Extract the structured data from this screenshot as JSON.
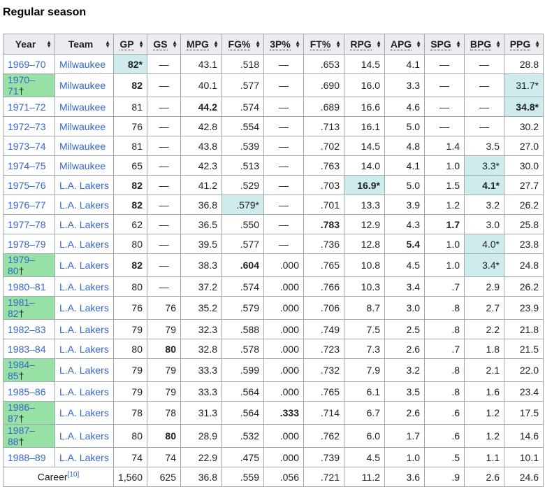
{
  "heading": "Regular season",
  "columns": [
    {
      "key": "year",
      "label": "Year",
      "abbr": false
    },
    {
      "key": "team",
      "label": "Team",
      "abbr": false
    },
    {
      "key": "gp",
      "label": "GP",
      "abbr": true
    },
    {
      "key": "gs",
      "label": "GS",
      "abbr": true
    },
    {
      "key": "mpg",
      "label": "MPG",
      "abbr": true
    },
    {
      "key": "fg",
      "label": "FG%",
      "abbr": true
    },
    {
      "key": "three",
      "label": "3P%",
      "abbr": true
    },
    {
      "key": "ft",
      "label": "FT%",
      "abbr": true
    },
    {
      "key": "rpg",
      "label": "RPG",
      "abbr": true
    },
    {
      "key": "apg",
      "label": "APG",
      "abbr": true
    },
    {
      "key": "spg",
      "label": "SPG",
      "abbr": true
    },
    {
      "key": "bpg",
      "label": "BPG",
      "abbr": true
    },
    {
      "key": "ppg",
      "label": "PPG",
      "abbr": true
    }
  ],
  "rows": [
    {
      "year": "1969–70",
      "team": "Milwaukee",
      "gp": "82*",
      "gs": "—",
      "mpg": "43.1",
      "fg": ".518",
      "three": "—",
      "ft": ".653",
      "rpg": "14.5",
      "apg": "4.1",
      "spg": "—",
      "bpg": "—",
      "ppg": "28.8",
      "lead": [
        "gp"
      ],
      "bold": [
        "gp"
      ]
    },
    {
      "year": "1970–71†",
      "team": "Milwaukee",
      "gp": "82",
      "gs": "—",
      "mpg": "40.1",
      "fg": ".577",
      "three": "—",
      "ft": ".690",
      "rpg": "16.0",
      "apg": "3.3",
      "spg": "—",
      "bpg": "—",
      "ppg": "31.7*",
      "champ": true,
      "lead": [
        "ppg"
      ],
      "bold": [
        "gp"
      ]
    },
    {
      "year": "1971–72",
      "team": "Milwaukee",
      "gp": "81",
      "gs": "—",
      "mpg": "44.2",
      "fg": ".574",
      "three": "—",
      "ft": ".689",
      "rpg": "16.6",
      "apg": "4.6",
      "spg": "—",
      "bpg": "—",
      "ppg": "34.8*",
      "lead": [
        "ppg"
      ],
      "bold": [
        "mpg",
        "ppg"
      ]
    },
    {
      "year": "1972–73",
      "team": "Milwaukee",
      "gp": "76",
      "gs": "—",
      "mpg": "42.8",
      "fg": ".554",
      "three": "—",
      "ft": ".713",
      "rpg": "16.1",
      "apg": "5.0",
      "spg": "—",
      "bpg": "—",
      "ppg": "30.2"
    },
    {
      "year": "1973–74",
      "team": "Milwaukee",
      "gp": "81",
      "gs": "—",
      "mpg": "43.8",
      "fg": ".539",
      "three": "—",
      "ft": ".702",
      "rpg": "14.5",
      "apg": "4.8",
      "spg": "1.4",
      "bpg": "3.5",
      "ppg": "27.0"
    },
    {
      "year": "1974–75",
      "team": "Milwaukee",
      "gp": "65",
      "gs": "—",
      "mpg": "42.3",
      "fg": ".513",
      "three": "—",
      "ft": ".763",
      "rpg": "14.0",
      "apg": "4.1",
      "spg": "1.0",
      "bpg": "3.3*",
      "ppg": "30.0",
      "lead": [
        "bpg"
      ]
    },
    {
      "year": "1975–76",
      "team": "L.A. Lakers",
      "gp": "82",
      "gs": "—",
      "mpg": "41.2",
      "fg": ".529",
      "three": "—",
      "ft": ".703",
      "rpg": "16.9*",
      "apg": "5.0",
      "spg": "1.5",
      "bpg": "4.1*",
      "ppg": "27.7",
      "lead": [
        "rpg",
        "bpg"
      ],
      "bold": [
        "gp",
        "rpg",
        "bpg"
      ]
    },
    {
      "year": "1976–77",
      "team": "L.A. Lakers",
      "gp": "82",
      "gs": "—",
      "mpg": "36.8",
      "fg": ".579*",
      "three": "—",
      "ft": ".701",
      "rpg": "13.3",
      "apg": "3.9",
      "spg": "1.2",
      "bpg": "3.2",
      "ppg": "26.2",
      "lead": [
        "fg"
      ],
      "bold": [
        "gp"
      ]
    },
    {
      "year": "1977–78",
      "team": "L.A. Lakers",
      "gp": "62",
      "gs": "—",
      "mpg": "36.5",
      "fg": ".550",
      "three": "—",
      "ft": ".783",
      "rpg": "12.9",
      "apg": "4.3",
      "spg": "1.7",
      "bpg": "3.0",
      "ppg": "25.8",
      "bold": [
        "ft",
        "spg"
      ]
    },
    {
      "year": "1978–79",
      "team": "L.A. Lakers",
      "gp": "80",
      "gs": "—",
      "mpg": "39.5",
      "fg": ".577",
      "three": "—",
      "ft": ".736",
      "rpg": "12.8",
      "apg": "5.4",
      "spg": "1.0",
      "bpg": "4.0*",
      "ppg": "23.8",
      "lead": [
        "bpg"
      ],
      "bold": [
        "apg"
      ]
    },
    {
      "year": "1979–80†",
      "team": "L.A. Lakers",
      "gp": "82",
      "gs": "—",
      "mpg": "38.3",
      "fg": ".604",
      "three": ".000",
      "ft": ".765",
      "rpg": "10.8",
      "apg": "4.5",
      "spg": "1.0",
      "bpg": "3.4*",
      "ppg": "24.8",
      "champ": true,
      "lead": [
        "bpg"
      ],
      "bold": [
        "gp",
        "fg"
      ]
    },
    {
      "year": "1980–81",
      "team": "L.A. Lakers",
      "gp": "80",
      "gs": "—",
      "mpg": "37.2",
      "fg": ".574",
      "three": ".000",
      "ft": ".766",
      "rpg": "10.3",
      "apg": "3.4",
      "spg": ".7",
      "bpg": "2.9",
      "ppg": "26.2"
    },
    {
      "year": "1981–82†",
      "team": "L.A. Lakers",
      "gp": "76",
      "gs": "76",
      "mpg": "35.2",
      "fg": ".579",
      "three": ".000",
      "ft": ".706",
      "rpg": "8.7",
      "apg": "3.0",
      "spg": ".8",
      "bpg": "2.7",
      "ppg": "23.9",
      "champ": true
    },
    {
      "year": "1982–83",
      "team": "L.A. Lakers",
      "gp": "79",
      "gs": "79",
      "mpg": "32.3",
      "fg": ".588",
      "three": ".000",
      "ft": ".749",
      "rpg": "7.5",
      "apg": "2.5",
      "spg": ".8",
      "bpg": "2.2",
      "ppg": "21.8"
    },
    {
      "year": "1983–84",
      "team": "L.A. Lakers",
      "gp": "80",
      "gs": "80",
      "mpg": "32.8",
      "fg": ".578",
      "three": ".000",
      "ft": ".723",
      "rpg": "7.3",
      "apg": "2.6",
      "spg": ".7",
      "bpg": "1.8",
      "ppg": "21.5",
      "bold": [
        "gs"
      ]
    },
    {
      "year": "1984–85†",
      "team": "L.A. Lakers",
      "gp": "79",
      "gs": "79",
      "mpg": "33.3",
      "fg": ".599",
      "three": ".000",
      "ft": ".732",
      "rpg": "7.9",
      "apg": "3.2",
      "spg": ".8",
      "bpg": "2.1",
      "ppg": "22.0",
      "champ": true
    },
    {
      "year": "1985–86",
      "team": "L.A. Lakers",
      "gp": "79",
      "gs": "79",
      "mpg": "33.3",
      "fg": ".564",
      "three": ".000",
      "ft": ".765",
      "rpg": "6.1",
      "apg": "3.5",
      "spg": ".8",
      "bpg": "1.6",
      "ppg": "23.4"
    },
    {
      "year": "1986–87†",
      "team": "L.A. Lakers",
      "gp": "78",
      "gs": "78",
      "mpg": "31.3",
      "fg": ".564",
      "three": ".333",
      "ft": ".714",
      "rpg": "6.7",
      "apg": "2.6",
      "spg": ".6",
      "bpg": "1.2",
      "ppg": "17.5",
      "champ": true,
      "bold": [
        "three"
      ]
    },
    {
      "year": "1987–88†",
      "team": "L.A. Lakers",
      "gp": "80",
      "gs": "80",
      "mpg": "28.9",
      "fg": ".532",
      "three": ".000",
      "ft": ".762",
      "rpg": "6.0",
      "apg": "1.7",
      "spg": ".6",
      "bpg": "1.2",
      "ppg": "14.6",
      "champ": true,
      "bold": [
        "gs"
      ]
    },
    {
      "year": "1988–89",
      "team": "L.A. Lakers",
      "gp": "74",
      "gs": "74",
      "mpg": "22.9",
      "fg": ".475",
      "three": ".000",
      "ft": ".739",
      "rpg": "4.5",
      "apg": "1.0",
      "spg": ".5",
      "bpg": "1.1",
      "ppg": "10.1"
    }
  ],
  "career": {
    "label": "Career",
    "ref": "[10]",
    "gp": "1,560",
    "gs": "625",
    "mpg": "36.8",
    "fg": ".559",
    "three": ".056",
    "ft": ".721",
    "rpg": "11.2",
    "apg": "3.6",
    "spg": ".9",
    "bpg": "2.6",
    "ppg": "24.6"
  },
  "colors": {
    "champion": "#98e1a5",
    "league_leader": "#cfecec",
    "header_bg": "#eaecf0",
    "link": "#3366cc",
    "border": "#a2a9b1"
  },
  "icons": {
    "sort": "sort-arrows-icon"
  }
}
